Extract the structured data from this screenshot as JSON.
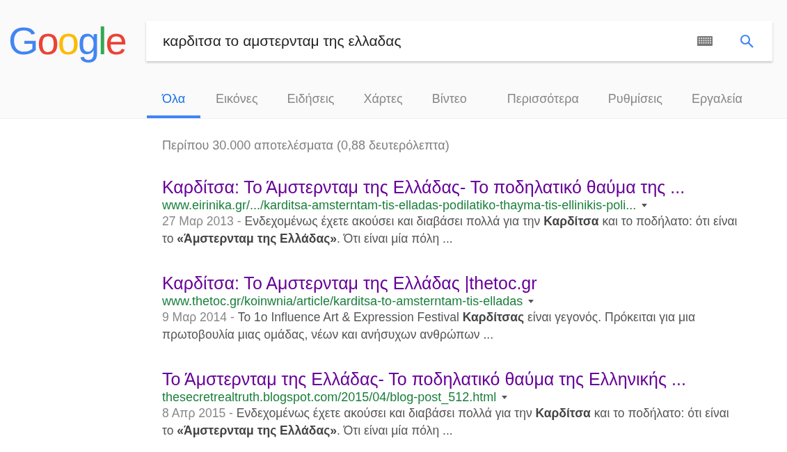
{
  "logo": "Google",
  "search": {
    "value": "καρδιτσα το αμστερνταμ της ελλαδας"
  },
  "tabs": [
    {
      "label": "Όλα",
      "selected": true
    },
    {
      "label": "Εικόνες",
      "selected": false
    },
    {
      "label": "Ειδήσεις",
      "selected": false
    },
    {
      "label": "Χάρτες",
      "selected": false
    },
    {
      "label": "Βίντεο",
      "selected": false
    },
    {
      "label": "Περισσότερα",
      "selected": false
    },
    {
      "label": "Ρυθμίσεις",
      "selected": false
    },
    {
      "label": "Εργαλεία",
      "selected": false
    }
  ],
  "result_stats": "Περίπου 30.000 αποτελέσματα (0,88 δευτερόλεπτα)",
  "results": [
    {
      "title": "Καρδίτσα: Το Άμστερνταμ της Ελλάδας- Το ποδηλατικό θαύμα της ...",
      "url": "www.eirinika.gr/.../karditsa-amsterntam-tis-elladas-podilatiko-thayma-tis-ellinikis-poli...",
      "date": "27 Μαρ 2013 -",
      "snippet": "Ενδεχομένως έχετε ακούσει και διαβάσει πολλά για την **Καρδίτσα** και το ποδήλατο: ότι είναι το **«Άμστερνταμ της Ελλάδας»**. Ότι είναι μία πόλη ..."
    },
    {
      "title": "Καρδίτσα: Το Αμστερνταμ της Ελλάδας |thetoc.gr",
      "url": "www.thetoc.gr/koinwnia/article/karditsa-to-amsterntam-tis-elladas",
      "date": "9 Μαρ 2014 -",
      "snippet": "Το 1ο Influence Art & Expression Festival **Καρδίτσας** είναι γεγονός. Πρόκειται για μια πρωτοβουλία μιας ομάδας, νέων και ανήσυχων ανθρώπων ..."
    },
    {
      "title": "Το Άμστερνταμ της Ελλάδας- Το ποδηλατικό θαύμα της Ελληνικής ...",
      "url": "thesecretrealtruth.blogspot.com/2015/04/blog-post_512.html",
      "date": "8 Απρ 2015 -",
      "snippet": "Ενδεχομένως έχετε ακούσει και διαβάσει πολλά για την **Καρδίτσα** και το ποδήλατο: ότι είναι το **«Άμστερνταμ της Ελλάδας»**. Ότι είναι μία πόλη ..."
    }
  ]
}
